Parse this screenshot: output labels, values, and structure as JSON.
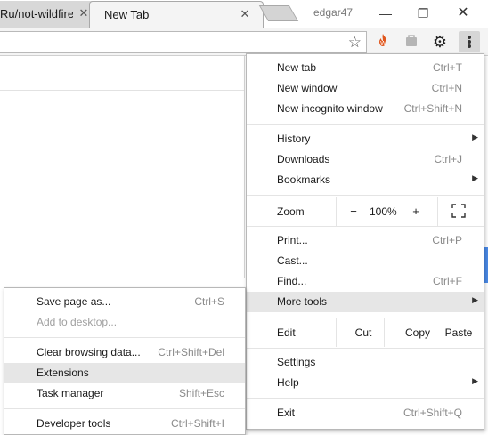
{
  "tabs": [
    {
      "title": "Ru/not-wildfire",
      "close": "✕"
    },
    {
      "title": "New Tab",
      "close": "✕"
    }
  ],
  "profile": {
    "name": "edgar47"
  },
  "window_controls": {
    "minimize": "—",
    "restore": "❐",
    "close": "✕"
  },
  "toolbar": {
    "bookmark_icon": "star-outline",
    "extensions": [
      "fire-icon",
      "bag-icon",
      "gear-icon"
    ],
    "menu_icon": "kebab-menu"
  },
  "main_menu": {
    "items": [
      {
        "label": "New tab",
        "shortcut": "Ctrl+T"
      },
      {
        "label": "New window",
        "shortcut": "Ctrl+N"
      },
      {
        "label": "New incognito window",
        "shortcut": "Ctrl+Shift+N"
      },
      {
        "label": "History",
        "arrow": "▶"
      },
      {
        "label": "Downloads",
        "shortcut": "Ctrl+J"
      },
      {
        "label": "Bookmarks",
        "arrow": "▶"
      },
      {
        "label": "Print...",
        "shortcut": "Ctrl+P"
      },
      {
        "label": "Cast..."
      },
      {
        "label": "Find...",
        "shortcut": "Ctrl+F"
      },
      {
        "label": "More tools",
        "arrow": "▶"
      },
      {
        "label": "Settings"
      },
      {
        "label": "Help",
        "arrow": "▶"
      },
      {
        "label": "Exit",
        "shortcut": "Ctrl+Shift+Q"
      }
    ],
    "zoom": {
      "label": "Zoom",
      "minus": "−",
      "value": "100%",
      "plus": "+"
    },
    "edit": {
      "label": "Edit",
      "cut": "Cut",
      "copy": "Copy",
      "paste": "Paste"
    }
  },
  "more_tools_menu": {
    "items": [
      {
        "label": "Save page as...",
        "shortcut": "Ctrl+S"
      },
      {
        "label": "Add to desktop..."
      },
      {
        "label": "Clear browsing data...",
        "shortcut": "Ctrl+Shift+Del"
      },
      {
        "label": "Extensions"
      },
      {
        "label": "Task manager",
        "shortcut": "Shift+Esc"
      },
      {
        "label": "Developer tools",
        "shortcut": "Ctrl+Shift+I"
      }
    ]
  },
  "colors": {
    "menu_highlight": "#e6e6e6",
    "accent": "#4a8ae8"
  }
}
